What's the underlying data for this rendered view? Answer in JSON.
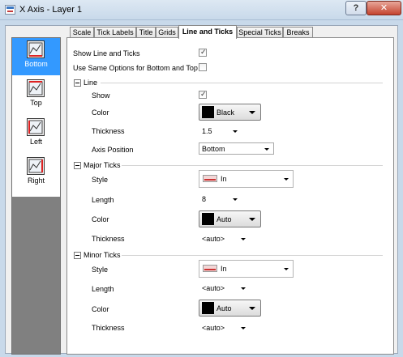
{
  "window": {
    "title": "X Axis - Layer 1",
    "help_glyph": "?",
    "close_glyph": "✕"
  },
  "sidebar": {
    "items": [
      {
        "label": "Bottom",
        "selected": true
      },
      {
        "label": "Top",
        "selected": false
      },
      {
        "label": "Left",
        "selected": false
      },
      {
        "label": "Right",
        "selected": false
      }
    ]
  },
  "tabs": [
    {
      "label": "Scale"
    },
    {
      "label": "Tick Labels"
    },
    {
      "label": "Title"
    },
    {
      "label": "Grids"
    },
    {
      "label": "Line and Ticks",
      "active": true
    },
    {
      "label": "Special Ticks"
    },
    {
      "label": "Breaks"
    }
  ],
  "options": {
    "show_line_ticks": {
      "label": "Show Line and Ticks",
      "checked": true
    },
    "same_options": {
      "label": "Use Same Options for Bottom and Top",
      "checked": false
    }
  },
  "line_group": {
    "title": "Line",
    "show_label": "Show",
    "show_checked": true,
    "color_label": "Color",
    "color_value": "Black",
    "thickness_label": "Thickness",
    "thickness_value": "1.5",
    "axis_position_label": "Axis Position",
    "axis_position_value": "Bottom"
  },
  "major_ticks": {
    "title": "Major Ticks",
    "style_label": "Style",
    "style_value": "In",
    "length_label": "Length",
    "length_value": "8",
    "color_label": "Color",
    "color_value": "Auto",
    "thickness_label": "Thickness",
    "thickness_value": "<auto>"
  },
  "minor_ticks": {
    "title": "Minor Ticks",
    "style_label": "Style",
    "style_value": "In",
    "length_label": "Length",
    "length_value": "<auto>",
    "color_label": "Color",
    "color_value": "Auto",
    "thickness_label": "Thickness",
    "thickness_value": "<auto>"
  },
  "colors": {
    "selection": "#3399ff",
    "sidebar_bg": "#808080",
    "tick_swatch_red": "#cc3333"
  }
}
